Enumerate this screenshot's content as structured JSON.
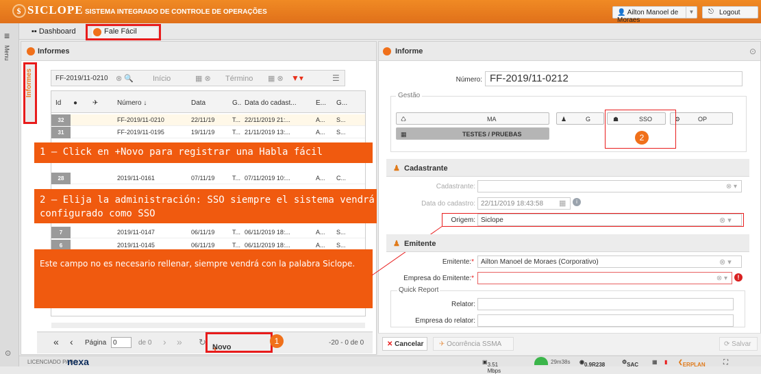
{
  "app": {
    "logo": "SICLOPE",
    "title": "SISTEMA INTEGRADO DE CONTROLE DE OPERAÇÕES",
    "user": "Ailton Manoel de Moraes",
    "logout": "Logout"
  },
  "rail": {
    "menu_label": "Menu"
  },
  "nav": {
    "dashboard": "Dashboard",
    "fale_facil": "Fale Fácil"
  },
  "left_panel": {
    "title": "Informes",
    "vtab": "Informes",
    "search_value": "FF-2019/11-0210",
    "inicio_placeholder": "Início",
    "termino_placeholder": "Término",
    "columns": [
      "Id",
      "",
      "",
      "Número ↓",
      "Data",
      "G..",
      "Data do cadast...",
      "E...",
      "G..."
    ],
    "rows": [
      {
        "id": "32",
        "numero": "FF-2019/11-0210",
        "data": "22/11/19",
        "g": "T...",
        "cadastro": "22/11/2019 21:...",
        "e": "A...",
        "g2": "S..."
      },
      {
        "id": "31",
        "numero": "FF-2019/11-0195",
        "data": "19/11/19",
        "g": "T...",
        "cadastro": "21/11/2019 13:...",
        "e": "A...",
        "g2": "S..."
      },
      {
        "id": "28",
        "numero": "2019/11-0161",
        "data": "07/11/19",
        "g": "T...",
        "cadastro": "07/11/2019 10:...",
        "e": "A...",
        "g2": "C..."
      },
      {
        "id": "7",
        "numero": "2019/11-0147",
        "data": "06/11/19",
        "g": "T...",
        "cadastro": "06/11/2019 18:...",
        "e": "A...",
        "g2": "S..."
      },
      {
        "id": "6",
        "numero": "2019/11-0145",
        "data": "06/11/19",
        "g": "T...",
        "cadastro": "06/11/2019 18:...",
        "e": "A...",
        "g2": "S..."
      }
    ],
    "pager": {
      "pagina": "Página",
      "page_value": "0",
      "de": "de 0",
      "novo": "Novo",
      "range": "-20 - 0 de 0"
    }
  },
  "annotations": {
    "step1": "1 – Click en +Novo para registrar una Habla fácil",
    "step2": "2 – Elija la administración: SSO siempre el sistema vendrá configurado como SSO",
    "note": "Este campo no es necesario rellenar, siempre vendrá con la palabra Siclope.",
    "badge1": "1",
    "badge2": "2"
  },
  "right_panel": {
    "title": "Informe",
    "numero_label": "Número:",
    "numero_value": "FF-2019/11-0212",
    "gestao": "Gestão",
    "buttons": {
      "ma": "MA",
      "g": "G",
      "sso": "SSO",
      "op": "OP",
      "testes": "TESTES / PRUEBAS"
    },
    "cadastrante": {
      "section": "Cadastrante",
      "label": "Cadastrante:",
      "data_label": "Data do cadastro:",
      "data_value": "22/11/2019 18:43:58",
      "origem_label": "Origem:",
      "origem_value": "Siclope"
    },
    "emitente": {
      "section": "Emitente",
      "label": "Emitente:",
      "value": "Ailton Manoel de Moraes (Corporativo)",
      "empresa_label": "Empresa do Emitente:",
      "quick_report": "Quick Report",
      "relator_label": "Relator:",
      "empresa_relator_label": "Empresa do relator:"
    },
    "footer": {
      "cancelar": "Cancelar",
      "ocorrencia": "Ocorrência SSMA",
      "salvar": "Salvar"
    }
  },
  "footer": {
    "licenciado": "LICENCIADO PARA:",
    "brand": "nexa",
    "speed": "3.51 Mbps",
    "time": "29m38s",
    "version": "0.9R238",
    "sac": "SAC",
    "erplan": "ERPLAN"
  }
}
